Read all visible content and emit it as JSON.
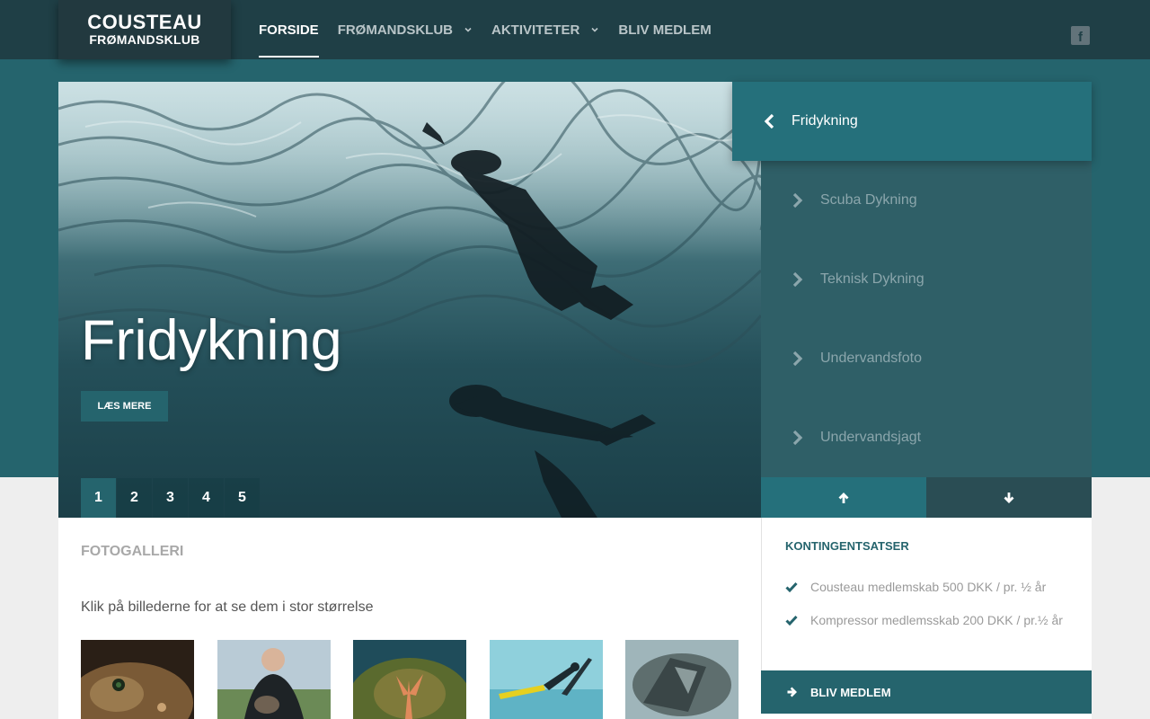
{
  "logo": {
    "line1": "COUSTEAU",
    "line2": "FRØMANDSKLUB"
  },
  "nav": {
    "items": [
      {
        "label": "FORSIDE",
        "active": true,
        "dropdown": false
      },
      {
        "label": "FRØMANDSKLUB",
        "active": false,
        "dropdown": true
      },
      {
        "label": "AKTIVITETER",
        "active": false,
        "dropdown": true
      },
      {
        "label": "BLIV MEDLEM",
        "active": false,
        "dropdown": false
      }
    ],
    "social_icon": "facebook-icon",
    "social_glyph": "f"
  },
  "hero": {
    "title": "Fridykning",
    "button_label": "LÆS MERE",
    "pages": [
      "1",
      "2",
      "3",
      "4",
      "5"
    ],
    "active_page": "1"
  },
  "slider_nav": {
    "active": "Fridykning",
    "items": [
      "Scuba Dykning",
      "Teknisk Dykning",
      "Undervandsfoto",
      "Undervandsjagt"
    ],
    "up_icon": "arrow-up-icon",
    "down_icon": "arrow-down-icon"
  },
  "gallery": {
    "heading": "FOTOGALLERI",
    "text": "Klik på billederne for at se dem i stor størrelse",
    "thumbs": [
      "fish-photo",
      "diver-with-fish-photo",
      "starfish-photo",
      "pool-divers-photo",
      "wreck-photo"
    ]
  },
  "kontingent": {
    "heading": "KONTINGENTSATSER",
    "rows": [
      "Cousteau medlemskab 500 DKK / pr. ½ år",
      "Kompressor medlemsskab 200 DKK / pr.½ år"
    ],
    "button_label": "BLIV MEDLEM"
  },
  "colors": {
    "primary": "#25646d",
    "navbar": "#1f3f46",
    "sidebar": "#2f5f67"
  }
}
